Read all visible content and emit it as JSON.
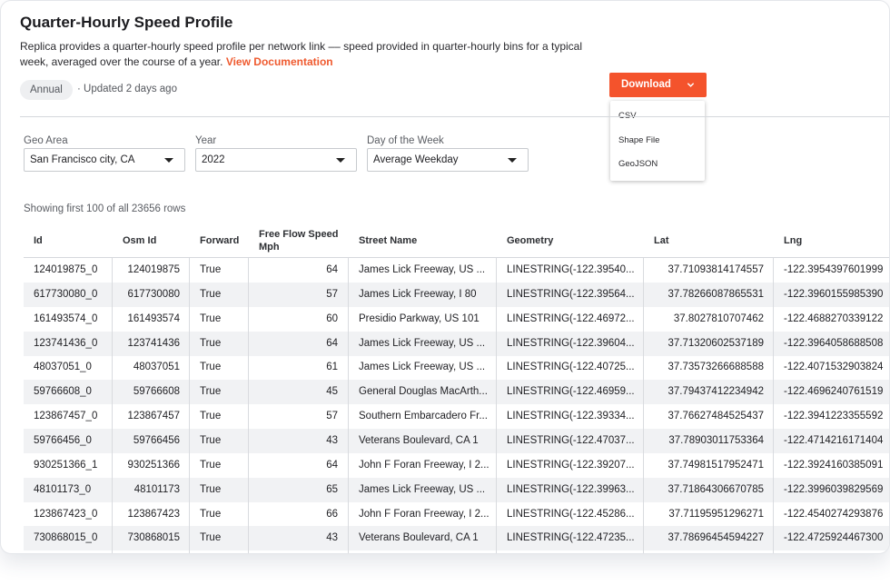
{
  "header": {
    "title": "Quarter-Hourly Speed Profile",
    "description": "Replica provides a quarter-hourly speed profile per network link –– speed provided in quarter-hourly bins for a typical week, averaged over the course of a year.",
    "doc_link": "View Documentation",
    "badge": "Annual",
    "updated": "· Updated 2 days ago"
  },
  "download": {
    "label": "Download",
    "options": [
      "CSV",
      "Shape File",
      "GeoJSON"
    ]
  },
  "filters": {
    "geo_area": {
      "label": "Geo Area",
      "value": "San Francisco city, CA"
    },
    "year": {
      "label": "Year",
      "value": "2022"
    },
    "day": {
      "label": "Day of the Week",
      "value": "Average Weekday"
    }
  },
  "row_count": "Showing first 100 of all 23656 rows",
  "table": {
    "columns": [
      "Id",
      "Osm Id",
      "Forward",
      "Free Flow Speed Mph",
      "Street Name",
      "Geometry",
      "Lat",
      "Lng"
    ],
    "rows": [
      [
        "124019875_0",
        "124019875",
        "True",
        "64",
        "James Lick Freeway, US ...",
        "LINESTRING(-122.39540...",
        "37.71093814174557",
        "-122.3954397601999"
      ],
      [
        "617730080_0",
        "617730080",
        "True",
        "57",
        "James Lick Freeway, I 80",
        "LINESTRING(-122.39564...",
        "37.78266087865531",
        "-122.3960155985390"
      ],
      [
        "161493574_0",
        "161493574",
        "True",
        "60",
        "Presidio Parkway, US 101",
        "LINESTRING(-122.46972...",
        "37.8027810707462",
        "-122.4688270339122"
      ],
      [
        "123741436_0",
        "123741436",
        "True",
        "64",
        "James Lick Freeway, US ...",
        "LINESTRING(-122.39604...",
        "37.71320602537189",
        "-122.3964058688508"
      ],
      [
        "48037051_0",
        "48037051",
        "True",
        "61",
        "James Lick Freeway, US ...",
        "LINESTRING(-122.40725...",
        "37.73573266688588",
        "-122.4071532903824"
      ],
      [
        "59766608_0",
        "59766608",
        "True",
        "45",
        "General Douglas MacArth...",
        "LINESTRING(-122.46959...",
        "37.79437412234942",
        "-122.4696240761519"
      ],
      [
        "123867457_0",
        "123867457",
        "True",
        "57",
        "Southern Embarcadero Fr...",
        "LINESTRING(-122.39334...",
        "37.76627484525437",
        "-122.3941223355592"
      ],
      [
        "59766456_0",
        "59766456",
        "True",
        "43",
        "Veterans Boulevard, CA 1",
        "LINESTRING(-122.47037...",
        "37.78903011753364",
        "-122.4714216171404"
      ],
      [
        "930251366_1",
        "930251366",
        "True",
        "64",
        "John F Foran Freeway, I 2...",
        "LINESTRING(-122.39207...",
        "37.74981517952471",
        "-122.3924160385091"
      ],
      [
        "48101173_0",
        "48101173",
        "True",
        "65",
        "James Lick Freeway, US ...",
        "LINESTRING(-122.39963...",
        "37.71864306670785",
        "-122.3996039829569"
      ],
      [
        "123867423_0",
        "123867423",
        "True",
        "66",
        "John F Foran Freeway, I 2...",
        "LINESTRING(-122.45286...",
        "37.71195951296271",
        "-122.4540274293876"
      ],
      [
        "730868015_0",
        "730868015",
        "True",
        "43",
        "Veterans Boulevard, CA 1",
        "LINESTRING(-122.47235...",
        "37.78696454594227",
        "-122.4725924467300"
      ]
    ]
  }
}
